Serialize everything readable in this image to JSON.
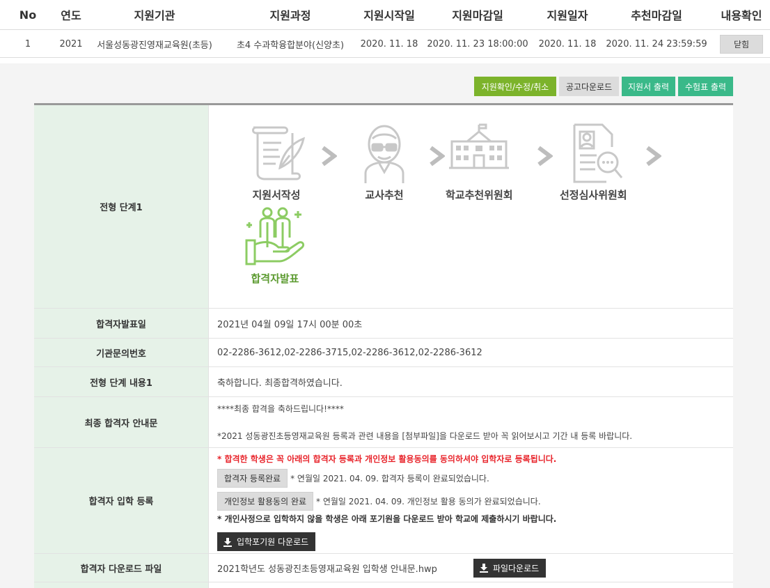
{
  "list": {
    "headers": [
      "No",
      "연도",
      "지원기관",
      "지원과정",
      "지원시작일",
      "지원마감일",
      "지원일자",
      "추천마감일",
      "내용확인"
    ],
    "row": {
      "no": "1",
      "year": "2021",
      "institution": "서울성동광진영재교육원(초등)",
      "course": "초4 수과학융합분야(신양초)",
      "start_date": "2020. 11. 18",
      "end_date": "2020. 11. 23 18:00:00",
      "apply_date": "2020. 11. 18",
      "recommend_deadline": "2020. 11. 24 23:59:59",
      "close_label": "닫힘"
    }
  },
  "toolbar": {
    "confirm_label": "지원확인/수정/취소",
    "notice_download_label": "공고다운로드",
    "application_print_label": "지원서 출력",
    "ticket_print_label": "수험표 출력"
  },
  "detail": {
    "stage_label": "전형 단계1",
    "stages": [
      {
        "label": "지원서작성",
        "icon": "document-quill-icon"
      },
      {
        "label": "교사추천",
        "icon": "teacher-icon"
      },
      {
        "label": "학교추천위원회",
        "icon": "school-building-icon"
      },
      {
        "label": "선정심사위원회",
        "icon": "review-magnifier-icon"
      },
      {
        "label": "합격자발표",
        "icon": "announcement-people-icon",
        "active": true
      }
    ],
    "announce_date_label": "합격자발표일",
    "announce_date_value": "2021년 04월 09일 17시 00분 00초",
    "phone_label": "기관문의번호",
    "phone_value": "02-2286-3612,02-2286-3715,02-2286-3612,02-2286-3612",
    "content_label": "전형 단계 내용1",
    "content_value": "축하합니다. 최종합격하였습니다.",
    "guide_label": "최종 합격자 안내문",
    "guide_line1": "****최종 합격을 축하드립니다!****",
    "guide_line2": "*2021 성동광진초등영재교육원 등록과 관련 내용을 [첨부파일]을 다운로드 받아 꼭 읽어보시고 기간 내 등록 바랍니다.",
    "enroll_label": "합격자 입학 등록",
    "enroll_notice": "* 합격한 학생은 꼭 아래의 합격자 등록과 개인정보 활용동의를 동의하셔야 입학자로 등록됩니다.",
    "register_btn": "합격자 등록완료",
    "register_text": "* 연월일 2021. 04. 09. 합격자 등록이 완료되었습니다.",
    "privacy_btn": "개인정보 활용동의 완료",
    "privacy_text": "* 연월일 2021. 04. 09. 개인정보 활용 동의가 완료되었습니다.",
    "giveup_notice": "* 개인사정으로 입학하지 않을 학생은 아래 포기원을 다운로드 받아 학교에 제출하시기 바랍니다.",
    "giveup_btn": "입학포기원 다운로드",
    "file_label": "합격자 다운로드 파일",
    "file_name": "2021학년도 성동광진초등영재교육원 입학생 안내문.hwp",
    "file_btn": "파일다운로드"
  },
  "colors": {
    "accent_green": "#7cb32b",
    "teal": "#3ab989",
    "label_bg": "#e6f2e8",
    "notice_red": "#e8242b"
  }
}
